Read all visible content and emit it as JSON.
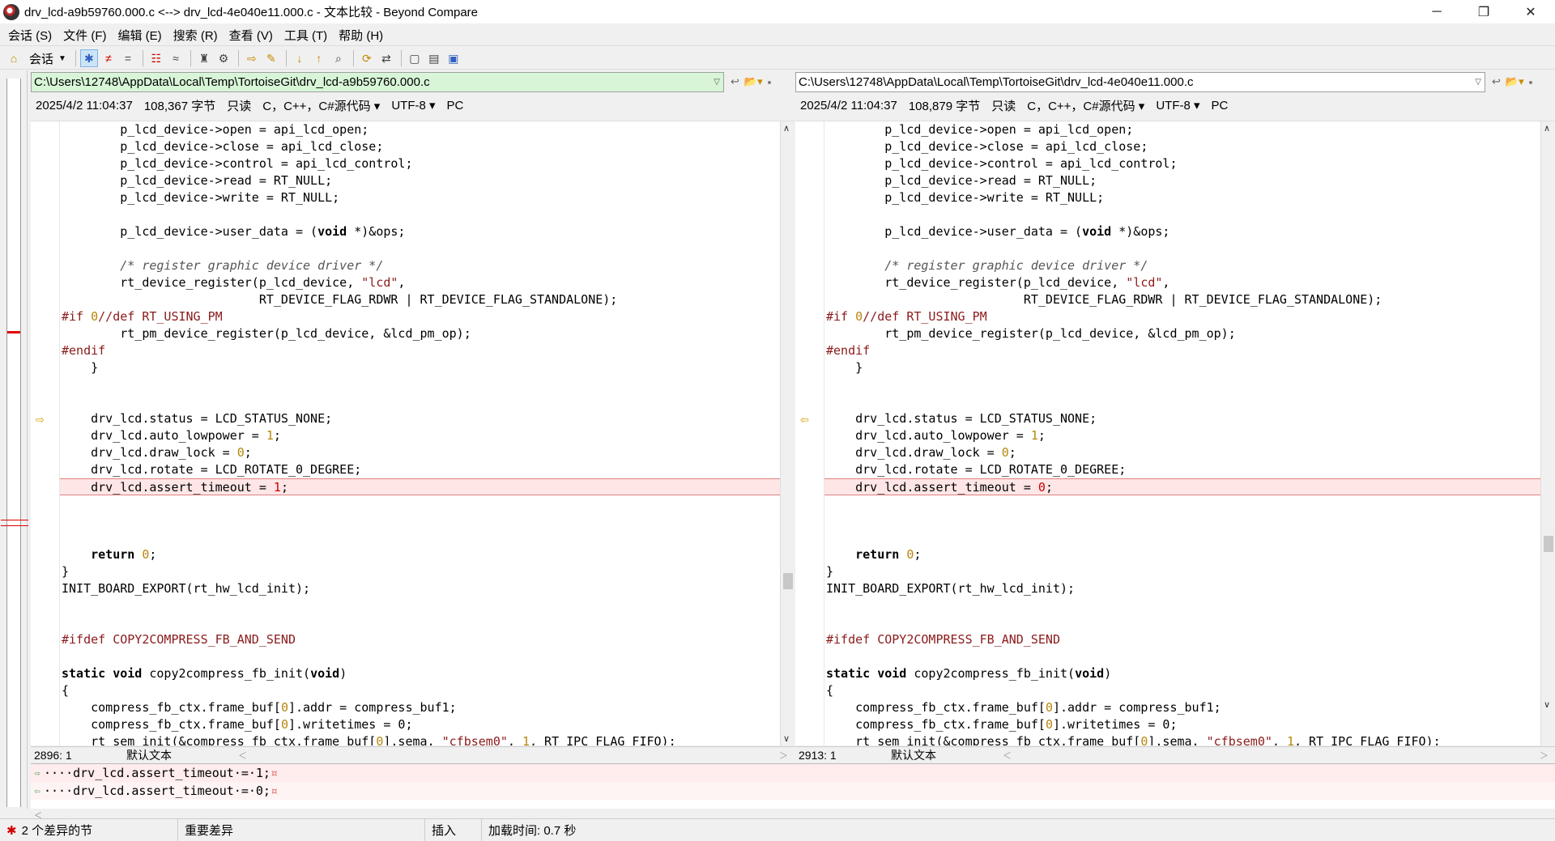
{
  "window": {
    "title": "drv_lcd-a9b59760.000.c <--> drv_lcd-4e040e11.000.c - 文本比较 - Beyond Compare",
    "controls": [
      "─",
      "❐",
      "✕"
    ]
  },
  "menu": [
    "会话 (S)",
    "文件 (F)",
    "编辑 (E)",
    "搜索 (R)",
    "查看 (V)",
    "工具 (T)",
    "帮助 (H)"
  ],
  "toolbar": {
    "session_label": "会话"
  },
  "left": {
    "path": "C:\\Users\\12748\\AppData\\Local\\Temp\\TortoiseGit\\drv_lcd-a9b59760.000.c",
    "date": "2025/4/2 11:04:37",
    "size": "108,367 字节",
    "mode": "只读",
    "lang": "C，C++，C#源代码",
    "encoding": "UTF-8",
    "eol": "PC",
    "position": "2896: 1",
    "filetype": "默认文本",
    "diff_value": "1"
  },
  "right": {
    "path": "C:\\Users\\12748\\AppData\\Local\\Temp\\TortoiseGit\\drv_lcd-4e040e11.000.c",
    "date": "2025/4/2 11:04:37",
    "size": "108,879 字节",
    "mode": "只读",
    "lang": "C，C++，C#源代码",
    "encoding": "UTF-8",
    "eol": "PC",
    "position": "2913: 1",
    "filetype": "默认文本",
    "diff_value": "0"
  },
  "code": {
    "l1": "        p_lcd_device->open = api_lcd_open;",
    "l2": "        p_lcd_device->close = api_lcd_close;",
    "l3": "        p_lcd_device->control = api_lcd_control;",
    "l4": "        p_lcd_device->read = RT_NULL;",
    "l5": "        p_lcd_device->write = RT_NULL;",
    "l6": "        p_lcd_device->user_data = (",
    "l6_kw": "void",
    "l6_tail": " *)&ops;",
    "l7_comment": "        /* register graphic device driver */",
    "l8": "        rt_device_register(p_lcd_device, ",
    "l8_str": "\"lcd\"",
    "l8_tail": ",",
    "l9": "                           RT_DEVICE_FLAG_RDWR | RT_DEVICE_FLAG_STANDALONE);",
    "l10_pp": "#if ",
    "l10_num": "0",
    "l10_rest": "//def RT_USING_PM",
    "l11": "        rt_pm_device_register(p_lcd_device, &lcd_pm_op);",
    "l12_pp": "#endif",
    "l13": "    }",
    "l14": "    drv_lcd.status = LCD_STATUS_NONE;",
    "l15": "    drv_lcd.auto_lowpower = ",
    "l15_num": "1",
    "l16": "    drv_lcd.draw_lock = ",
    "l16_num": "0",
    "l17": "    drv_lcd.rotate = LCD_ROTATE_0_DEGREE;",
    "l18": "    drv_lcd.assert_timeout = ",
    "l19_kw": "return",
    "l19_num": "0",
    "l20": "}",
    "l21": "INIT_BOARD_EXPORT(rt_hw_lcd_init);",
    "l22": "#ifdef COPY2COMPRESS_FB_AND_SEND",
    "l23_kw1": "static",
    "l23_kw2": "void",
    "l23_mid": " copy2compress_fb_init(",
    "l24": "{",
    "l25a": "    compress_fb_ctx.frame_buf[",
    "l25b": "].addr = compress_buf1;",
    "l26b": "].writetimes = 0;",
    "l27a": "    rt_sem_init(&compress_fb_ctx.frame_buf[",
    "l27b": "].sema, ",
    "l27_str": "\"cfbsem0\"",
    "l27c": ", ",
    "l27_num": "1",
    "l27d": ", RT_IPC_FLAG_FIFO);"
  },
  "detail": {
    "line1": "····drv_lcd.assert_timeout·=·1;",
    "line2": "····drv_lcd.assert_timeout·=·0;",
    "eol_mark": "¤"
  },
  "statusbar": {
    "diff_count": "2 个差异的节",
    "diff_kind": "重要差异",
    "insert_mode": "插入",
    "load_time": "加载时间:  0.7 秒"
  },
  "colors": {
    "diff_bg": "#ffe6e6",
    "diff_text": "#d00000",
    "left_path_bg": "#d8f5d8"
  }
}
